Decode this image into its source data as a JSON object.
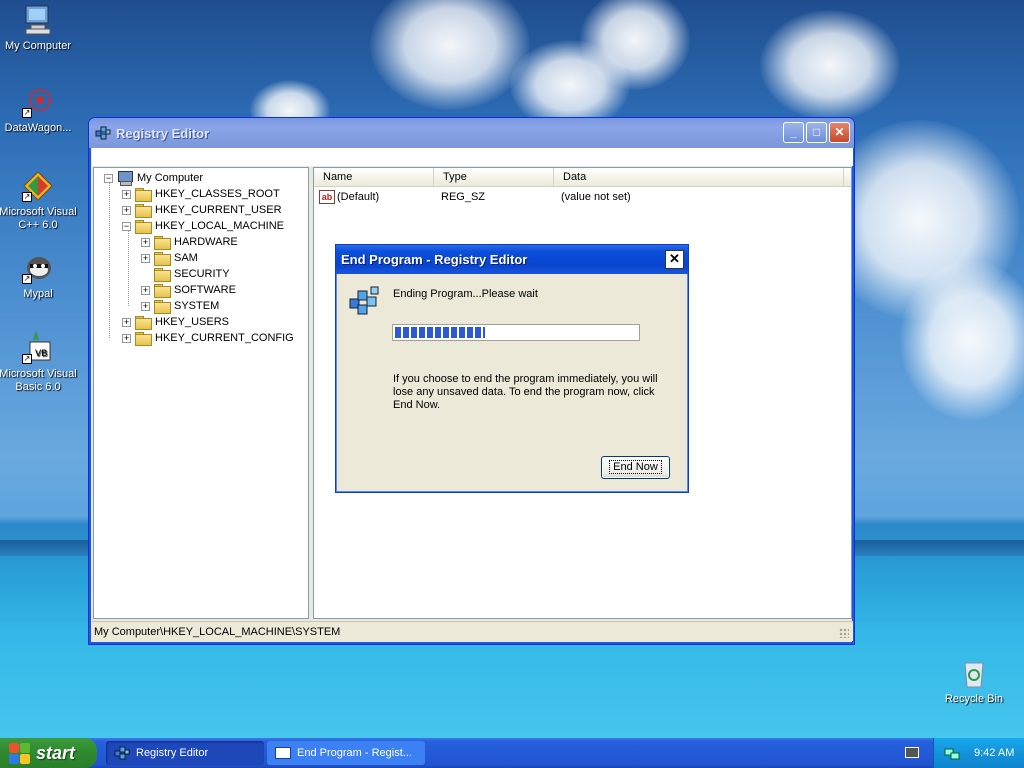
{
  "desktop": {
    "icons": [
      {
        "label": "My Computer",
        "icon": "computer-icon"
      },
      {
        "label": "DataWagon...",
        "icon": "datawagon-icon"
      },
      {
        "label": "Microsoft Visual C++ 6.0",
        "icon": "visual-cpp-icon"
      },
      {
        "label": "Mypal",
        "icon": "mypal-icon"
      },
      {
        "label": "Microsoft Visual Basic 6.0",
        "icon": "visual-basic-icon"
      },
      {
        "label": "Recycle Bin",
        "icon": "recycle-bin-icon"
      }
    ]
  },
  "registry_window": {
    "title": "Registry Editor",
    "tree": {
      "root": "My Computer",
      "nodes": [
        {
          "label": "HKEY_CLASSES_ROOT",
          "expander": "+"
        },
        {
          "label": "HKEY_CURRENT_USER",
          "expander": "+"
        },
        {
          "label": "HKEY_LOCAL_MACHINE",
          "expander": "−"
        },
        {
          "label": "HARDWARE",
          "expander": "+"
        },
        {
          "label": "SAM",
          "expander": "+"
        },
        {
          "label": "SECURITY",
          "expander": ""
        },
        {
          "label": "SOFTWARE",
          "expander": "+"
        },
        {
          "label": "SYSTEM",
          "expander": "+"
        },
        {
          "label": "HKEY_USERS",
          "expander": "+"
        },
        {
          "label": "HKEY_CURRENT_CONFIG",
          "expander": "+"
        }
      ]
    },
    "columns": [
      "Name",
      "Type",
      "Data"
    ],
    "values": [
      {
        "name": "(Default)",
        "type": "REG_SZ",
        "data": "(value not set)"
      }
    ],
    "status_path": "My Computer\\HKEY_LOCAL_MACHINE\\SYSTEM",
    "icon_labels": {
      "ab": "ab"
    }
  },
  "dialog": {
    "title": "End Program - Registry Editor",
    "message": "Ending Program...Please wait",
    "progress_fraction": 0.37,
    "warning": "If you choose to end the program immediately, you will lose any unsaved data. To end the program now, click End Now.",
    "button_label": "End Now",
    "close_glyph": "✕"
  },
  "taskbar": {
    "start_label": "start",
    "tasks": [
      {
        "label": "Registry Editor",
        "state": "active"
      },
      {
        "label": "End Program - Regist...",
        "state": "normal"
      }
    ],
    "clock": "9:42 AM"
  },
  "titlebar_buttons": {
    "minimize": "_",
    "maximize": "□",
    "close": "✕"
  },
  "colors": {
    "xp_blue": "#0a4ed9",
    "start_green": "#2f8c2f",
    "progress_blue": "#2b57d8"
  }
}
